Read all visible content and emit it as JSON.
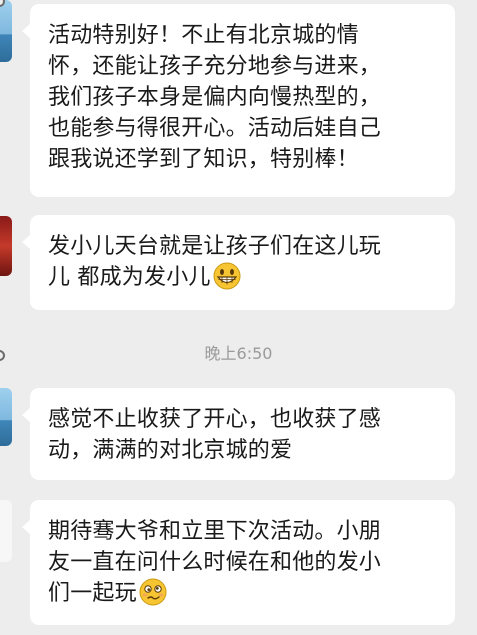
{
  "messages": [
    {
      "lines": [
        "活动特别好！不止有北京城的情",
        "怀，还能让孩子充分地参与进来，",
        "我们孩子本身是偏内向慢热型的，",
        "也能参与得很开心。活动后娃自己",
        "跟我说还学到了知识，特别棒！"
      ]
    },
    {
      "lines": [
        "发小儿天台就是让孩子们在这儿玩",
        "儿 都成为发小儿"
      ],
      "emoji": "grinning-face-emoji"
    },
    {
      "lines": [
        "感觉不止收获了开心，也收获了感",
        "动，满满的对北京城的爱"
      ]
    },
    {
      "lines": [
        "期待骞大爷和立里下次活动。小朋",
        "友一直在问什么时候在和他的发小",
        "们一起玩"
      ],
      "emoji": "woozy-face-emoji"
    }
  ],
  "timestamp": "晚上6:50"
}
